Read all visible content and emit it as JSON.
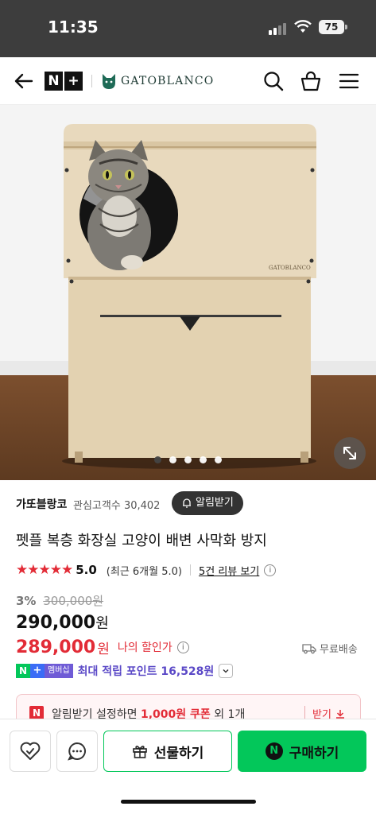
{
  "status_bar": {
    "time": "11:35",
    "battery": "75"
  },
  "header": {
    "brand": "GATOBLANCO",
    "membership_logo": "N+"
  },
  "hero": {
    "carousel_count": 5,
    "active_index": 0,
    "cabinet_label": "GATOBLANCO",
    "icons": [
      "expand-icon"
    ]
  },
  "store": {
    "name": "가또블랑코",
    "fans_label": "관심고객수",
    "fans_count": "30,402",
    "alarm_button": "알림받기"
  },
  "product": {
    "title": "펫플 복층 화장실 고양이 배변 사막화 방지",
    "stars": "★★★★★",
    "rating": "5.0",
    "recent_rating": "(최근 6개월 5.0)",
    "reviews_link": "5건 리뷰 보기"
  },
  "price": {
    "discount_pct": "3%",
    "original": "300,000원",
    "sale_amount": "290,000",
    "won": "원",
    "my_amount": "289,000",
    "my_label": "나의 할인가",
    "shipping": "무료배송"
  },
  "points": {
    "badge_n": "N",
    "badge_plus": "+",
    "badge_member": "멤버십",
    "text": "최대 적립 포인트 16,528원"
  },
  "coupon": {
    "prefix": "알림받기 설정하면",
    "amount": "1,000원 쿠폰",
    "suffix": "외 1개",
    "action": "받기"
  },
  "bottom_bar": {
    "gift_label": "선물하기",
    "buy_label": "구매하기",
    "buy_badge": "N"
  },
  "colors": {
    "naver_green": "#03c75a",
    "sale_red": "#e22b36",
    "points_purple": "#5b49c7",
    "status_bar": "#3d3d3d"
  }
}
